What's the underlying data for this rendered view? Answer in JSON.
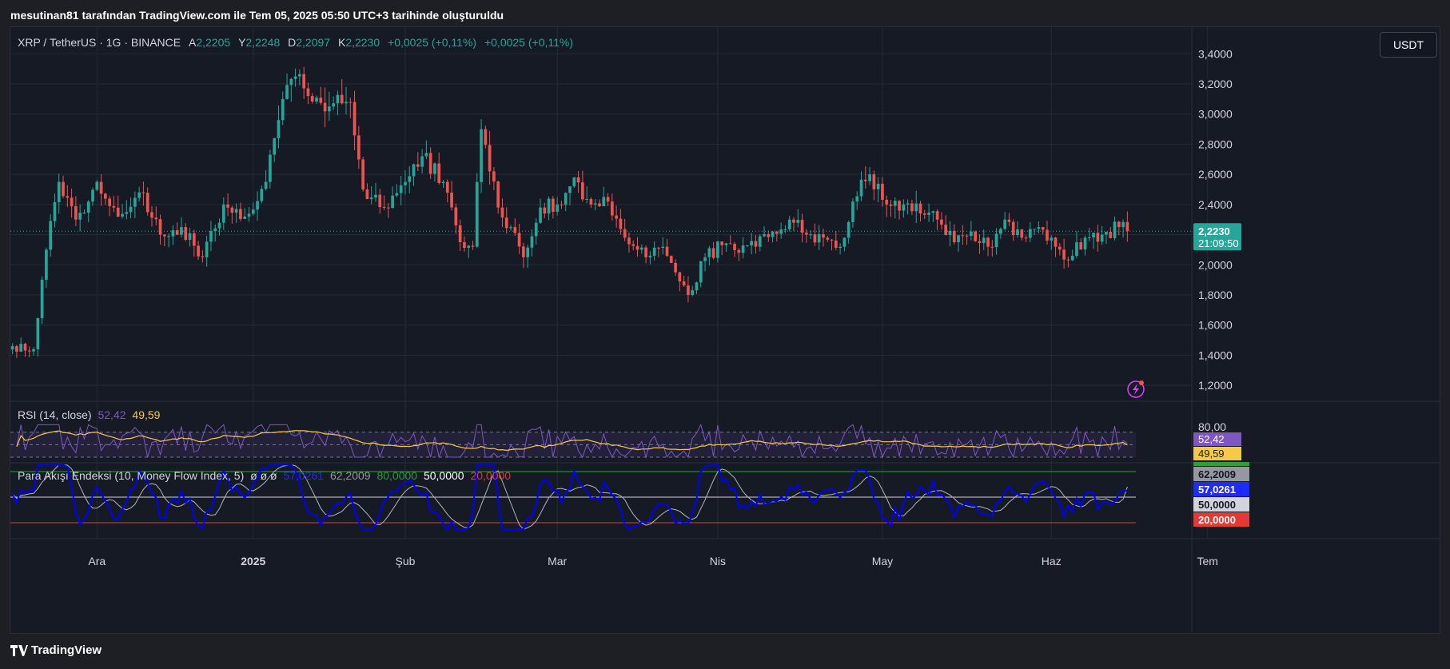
{
  "caption": "mesutinan81 tarafından TradingView.com ile Tem 05, 2025 05:50 UTC+3 tarihinde oluşturuldu",
  "footer": {
    "brand": "TradingView"
  },
  "colors": {
    "up": "#26a69a",
    "down": "#ef5350",
    "rsi": "#7e57c2",
    "rsi_ma": "#f7c948",
    "mfi": "#0000ff",
    "mfi_ma": "#b2b5be"
  },
  "main_legend": {
    "symbol": "XRP / TetherUS · 1G · BINANCE",
    "a_label": "A",
    "a_value": "2,2205",
    "y_label": "Y",
    "y_value": "2,2248",
    "d_label": "D",
    "d_value": "2,2097",
    "k_label": "K",
    "k_value": "2,2230",
    "change1": "+0,0025 (+0,11%)",
    "change2": "+0,0025 (+0,11%)"
  },
  "currency": "USDT",
  "last_price": {
    "value": "2,2230",
    "countdown": "21:09:50"
  },
  "rsi_legend": {
    "name": "RSI (14, close)",
    "value": "52,42",
    "ma_value": "49,59"
  },
  "mfi_legend": {
    "name": "Para Akışı Endeksi (10, Money Flow Index, 5)",
    "glyphs": "ø ø ø",
    "mfi_value": "57,0261",
    "ma_value": "62,2009",
    "upper": "80,0000",
    "middle": "50,0000",
    "lower": "20,0000"
  },
  "badges": {
    "rsi": "52,42",
    "rsi_ma": "49,59",
    "mfi_ma": "62,2009",
    "mfi": "57,0261",
    "mfi_mid": "50,0000",
    "mfi_low": "20,0000"
  },
  "chart_data": {
    "type": "candlestick",
    "symbol": "XRP / TetherUS",
    "interval": "1G",
    "exchange": "BINANCE",
    "price_axis": [
      "3,4000",
      "3,2000",
      "3,0000",
      "2,8000",
      "2,6000",
      "2,4000",
      "2,2000",
      "2,0000",
      "1,8000",
      "1,6000",
      "1,4000",
      "1,2000"
    ],
    "ylim": [
      1.1,
      3.55
    ],
    "time_axis": [
      "Ara",
      "2025",
      "Şub",
      "Mar",
      "Nis",
      "May",
      "Haz",
      "Tem"
    ],
    "close_anchors": [
      {
        "d": 0,
        "c": 1.46
      },
      {
        "d": 5,
        "c": 1.44
      },
      {
        "d": 8,
        "c": 2.1
      },
      {
        "d": 11,
        "c": 2.55
      },
      {
        "d": 15,
        "c": 2.3
      },
      {
        "d": 20,
        "c": 2.55
      },
      {
        "d": 25,
        "c": 2.32
      },
      {
        "d": 30,
        "c": 2.48
      },
      {
        "d": 35,
        "c": 2.2
      },
      {
        "d": 40,
        "c": 2.25
      },
      {
        "d": 45,
        "c": 2.05
      },
      {
        "d": 50,
        "c": 2.4
      },
      {
        "d": 55,
        "c": 2.32
      },
      {
        "d": 60,
        "c": 2.55
      },
      {
        "d": 64,
        "c": 3.1
      },
      {
        "d": 67,
        "c": 3.25
      },
      {
        "d": 70,
        "c": 3.12
      },
      {
        "d": 75,
        "c": 3.05
      },
      {
        "d": 80,
        "c": 3.08
      },
      {
        "d": 83,
        "c": 2.5
      },
      {
        "d": 88,
        "c": 2.38
      },
      {
        "d": 93,
        "c": 2.55
      },
      {
        "d": 97,
        "c": 2.72
      },
      {
        "d": 102,
        "c": 2.55
      },
      {
        "d": 106,
        "c": 2.15
      },
      {
        "d": 109,
        "c": 2.12
      },
      {
        "d": 111,
        "c": 2.9
      },
      {
        "d": 115,
        "c": 2.38
      },
      {
        "d": 118,
        "c": 2.25
      },
      {
        "d": 121,
        "c": 2.05
      },
      {
        "d": 125,
        "c": 2.38
      },
      {
        "d": 129,
        "c": 2.4
      },
      {
        "d": 133,
        "c": 2.58
      },
      {
        "d": 137,
        "c": 2.4
      },
      {
        "d": 141,
        "c": 2.42
      },
      {
        "d": 145,
        "c": 2.18
      },
      {
        "d": 150,
        "c": 2.05
      },
      {
        "d": 154,
        "c": 2.12
      },
      {
        "d": 157,
        "c": 1.95
      },
      {
        "d": 160,
        "c": 1.8
      },
      {
        "d": 164,
        "c": 2.05
      },
      {
        "d": 168,
        "c": 2.13
      },
      {
        "d": 172,
        "c": 2.08
      },
      {
        "d": 176,
        "c": 2.12
      },
      {
        "d": 180,
        "c": 2.22
      },
      {
        "d": 184,
        "c": 2.3
      },
      {
        "d": 188,
        "c": 2.2
      },
      {
        "d": 192,
        "c": 2.18
      },
      {
        "d": 196,
        "c": 2.12
      },
      {
        "d": 199,
        "c": 2.42
      },
      {
        "d": 203,
        "c": 2.6
      },
      {
        "d": 207,
        "c": 2.4
      },
      {
        "d": 211,
        "c": 2.4
      },
      {
        "d": 215,
        "c": 2.34
      },
      {
        "d": 219,
        "c": 2.3
      },
      {
        "d": 223,
        "c": 2.15
      },
      {
        "d": 227,
        "c": 2.22
      },
      {
        "d": 231,
        "c": 2.12
      },
      {
        "d": 235,
        "c": 2.3
      },
      {
        "d": 239,
        "c": 2.18
      },
      {
        "d": 243,
        "c": 2.25
      },
      {
        "d": 247,
        "c": 2.12
      },
      {
        "d": 250,
        "c": 2.03
      },
      {
        "d": 254,
        "c": 2.18
      },
      {
        "d": 258,
        "c": 2.2
      },
      {
        "d": 262,
        "c": 2.25
      },
      {
        "d": 264,
        "c": 2.223
      }
    ],
    "rsi_axis": [
      "80,00"
    ],
    "rsi_last": 52.42,
    "rsi_ma_last": 49.59,
    "mfi_last": 57.0261,
    "mfi_ma_last": 62.2009,
    "mfi_levels": [
      80,
      50,
      20
    ],
    "grid": true
  }
}
